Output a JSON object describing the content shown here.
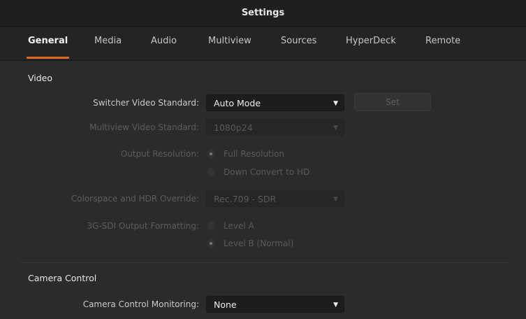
{
  "window": {
    "title": "Settings"
  },
  "tabs": [
    {
      "label": "General",
      "active": true
    },
    {
      "label": "Media"
    },
    {
      "label": "Audio"
    },
    {
      "label": "Multiview"
    },
    {
      "label": "Sources"
    },
    {
      "label": "HyperDeck"
    },
    {
      "label": "Remote"
    }
  ],
  "colors": {
    "accent": "#e06a20",
    "background": "#2b2b2b",
    "titlebar": "#1f1f1f"
  },
  "video": {
    "heading": "Video",
    "switcher_standard": {
      "label": "Switcher Video Standard:",
      "value": "Auto Mode"
    },
    "set_button": "Set",
    "multiview_standard": {
      "label": "Multiview Video Standard:",
      "value": "1080p24"
    },
    "output_resolution": {
      "label": "Output Resolution:",
      "options": [
        "Full Resolution",
        "Down Convert to HD"
      ],
      "selected": "Full Resolution"
    },
    "colorspace": {
      "label": "Colorspace and HDR Override:",
      "value": "Rec.709 - SDR"
    },
    "sdi_output": {
      "label": "3G-SDI Output Formatting:",
      "options": [
        "Level A",
        "Level B (Normal)"
      ],
      "selected": "Level B (Normal)"
    }
  },
  "camera_control": {
    "heading": "Camera Control",
    "monitoring": {
      "label": "Camera Control Monitoring:",
      "value": "None"
    }
  }
}
